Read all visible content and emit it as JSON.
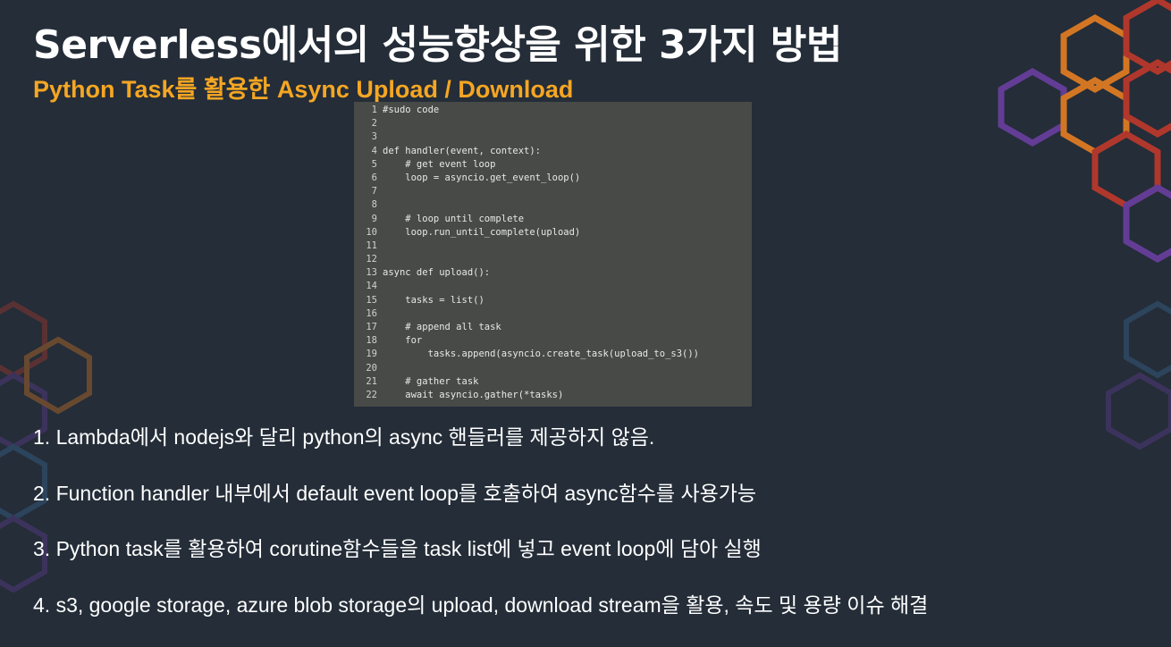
{
  "slide": {
    "title": "Serverless에서의 성능향상을 위한 3가지 방법",
    "subtitle": "Python Task를 활용한 Async Upload / Download"
  },
  "code": {
    "lines": [
      {
        "num": "1",
        "text": "#sudo code"
      },
      {
        "num": "2",
        "text": ""
      },
      {
        "num": "3",
        "text": ""
      },
      {
        "num": "4",
        "text": "def handler(event, context):"
      },
      {
        "num": "5",
        "text": "    # get event loop"
      },
      {
        "num": "6",
        "text": "    loop = asyncio.get_event_loop()"
      },
      {
        "num": "7",
        "text": ""
      },
      {
        "num": "8",
        "text": ""
      },
      {
        "num": "9",
        "text": "    # loop until complete"
      },
      {
        "num": "10",
        "text": "    loop.run_until_complete(upload)"
      },
      {
        "num": "11",
        "text": ""
      },
      {
        "num": "12",
        "text": ""
      },
      {
        "num": "13",
        "text": "async def upload():"
      },
      {
        "num": "14",
        "text": ""
      },
      {
        "num": "15",
        "text": "    tasks = list()"
      },
      {
        "num": "16",
        "text": ""
      },
      {
        "num": "17",
        "text": "    # append all task"
      },
      {
        "num": "18",
        "text": "    for"
      },
      {
        "num": "19",
        "text": "        tasks.append(asyncio.create_task(upload_to_s3())"
      },
      {
        "num": "20",
        "text": ""
      },
      {
        "num": "21",
        "text": "    # gather task"
      },
      {
        "num": "22",
        "text": "    await asyncio.gather(*tasks)"
      }
    ]
  },
  "points": [
    "1. Lambda에서 nodejs와 달리 python의 async 핸들러를 제공하지 않음.",
    "2. Function handler 내부에서 default event loop를 호출하여 async함수를 사용가능",
    "3. Python task를 활용하여 corutine함수들을 task list에 넣고 event loop에 담아 실행",
    "4. s3, google storage, azure blob storage의 upload, download stream을 활용, 속도 및 용량 이슈 해결"
  ],
  "colors": {
    "background": "#242d38",
    "title": "#ffffff",
    "subtitle": "#f5a623",
    "code_bg": "#474a47",
    "decor": [
      "#5a3f8a",
      "#c0392b",
      "#e67e22",
      "#3c6fa0"
    ]
  }
}
